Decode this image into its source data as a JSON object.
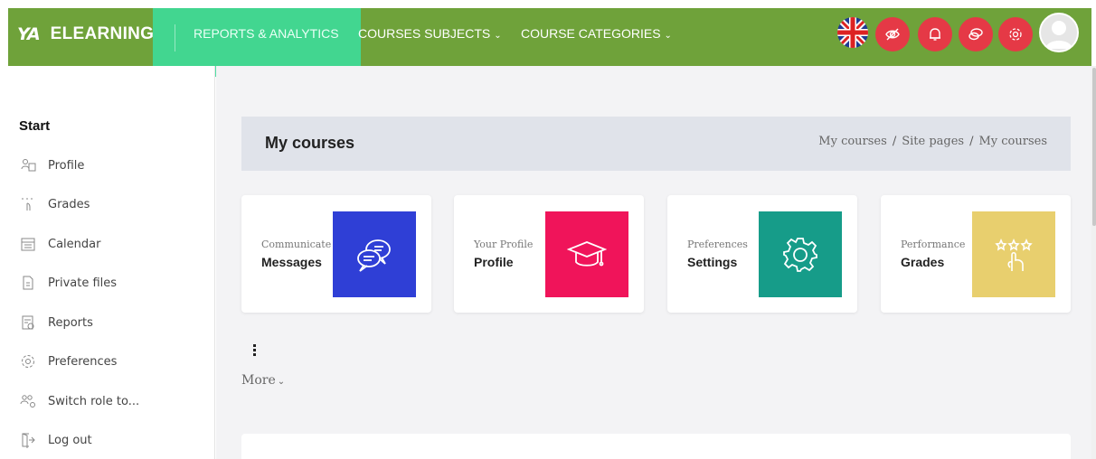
{
  "brand": {
    "mark": "YA",
    "name": "ELEARNING"
  },
  "nav": {
    "active": "REPORTS & ANALYTICS",
    "subjects": "COURSES SUBJECTS",
    "categories": "COURSE CATEGORIES",
    "chevron": "⌄"
  },
  "header_icons": [
    "uk-flag-icon",
    "eye-slash-icon",
    "bell-icon",
    "chat-icon",
    "gear-icon",
    "user-avatar-icon"
  ],
  "sidebar": {
    "title": "Start",
    "items": [
      {
        "label": "Profile",
        "icon": "profile-icon"
      },
      {
        "label": "Grades",
        "icon": "grades-icon"
      },
      {
        "label": "Calendar",
        "icon": "calendar-icon"
      },
      {
        "label": "Private files",
        "icon": "file-icon"
      },
      {
        "label": "Reports",
        "icon": "reports-icon"
      },
      {
        "label": "Preferences",
        "icon": "gear-icon"
      },
      {
        "label": "Switch role to...",
        "icon": "switch-role-icon"
      },
      {
        "label": "Log out",
        "icon": "logout-icon"
      }
    ]
  },
  "page": {
    "title": "My courses",
    "breadcrumb": [
      "My courses",
      "Site pages",
      "My courses"
    ],
    "breadcrumb_sep": "/"
  },
  "cards": [
    {
      "subtitle": "Communicate",
      "title": "Messages",
      "icon": "chat-bubbles-icon",
      "color": "#2f3fd6"
    },
    {
      "subtitle": "Your Profile",
      "title": "Profile",
      "icon": "graduation-cap-icon",
      "color": "#f0145a"
    },
    {
      "subtitle": "Preferences",
      "title": "Settings",
      "icon": "gear-icon",
      "color": "#169c89"
    },
    {
      "subtitle": "Performance",
      "title": "Grades",
      "icon": "stars-hand-icon",
      "color": "#e8cf6e"
    }
  ],
  "more": {
    "label": "More",
    "chevron": "⌄"
  },
  "colors": {
    "topbar": "#6fa23a",
    "active_nav": "#3ddc9a",
    "header_icon_bg": "#e53946"
  }
}
